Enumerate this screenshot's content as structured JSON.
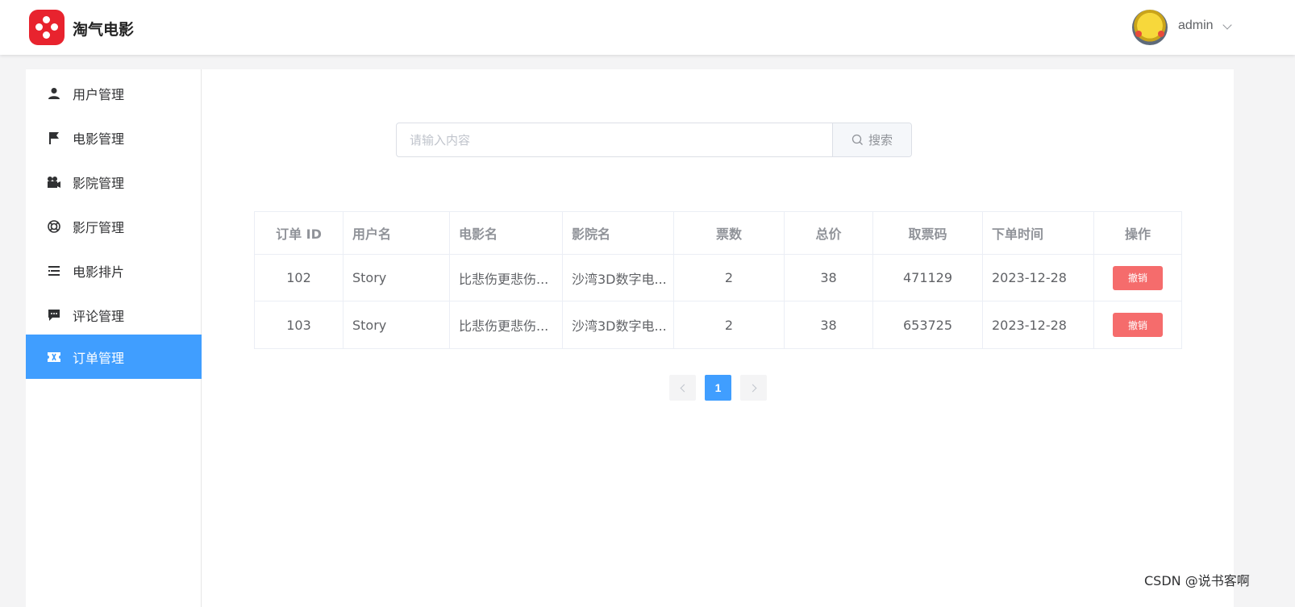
{
  "header": {
    "brand": "淘气电影",
    "username": "admin",
    "logo_icon": "film-reel-icon",
    "avatar_icon": "pikachu-avatar"
  },
  "sidebar": {
    "items": [
      {
        "label": "用户管理",
        "icon": "user-icon"
      },
      {
        "label": "电影管理",
        "icon": "flag-icon"
      },
      {
        "label": "影院管理",
        "icon": "video-camera-icon"
      },
      {
        "label": "影厅管理",
        "icon": "lifebuoy-icon"
      },
      {
        "label": "电影排片",
        "icon": "list-icon"
      },
      {
        "label": "评论管理",
        "icon": "comment-icon"
      },
      {
        "label": "订单管理",
        "icon": "ticket-icon",
        "active": true
      }
    ]
  },
  "search": {
    "placeholder": "请输入内容",
    "button_label": "搜索"
  },
  "table": {
    "columns": [
      "订单 ID",
      "用户名",
      "电影名",
      "影院名",
      "票数",
      "总价",
      "取票码",
      "下单时间",
      "操作"
    ],
    "rows": [
      {
        "id": "102",
        "user": "Story",
        "movie": "比悲伤更悲伤...",
        "cinema": "沙湾3D数字电...",
        "tickets": "2",
        "price": "38",
        "code": "471129",
        "time": "2023-12-28",
        "action": "撤销"
      },
      {
        "id": "103",
        "user": "Story",
        "movie": "比悲伤更悲伤...",
        "cinema": "沙湾3D数字电...",
        "tickets": "2",
        "price": "38",
        "code": "653725",
        "time": "2023-12-28",
        "action": "撤销"
      }
    ]
  },
  "pagination": {
    "current_page": "1"
  },
  "watermark": "CSDN @说书客啊",
  "colors": {
    "primary": "#409eff",
    "danger": "#f56c6c",
    "brand_red": "#e8232e"
  }
}
